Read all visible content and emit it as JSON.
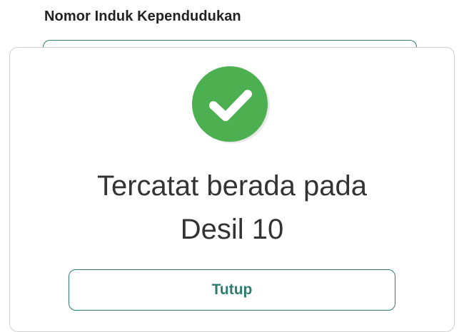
{
  "form": {
    "nik_label": "Nomor Induk Kependudukan",
    "nik_value": ""
  },
  "dialog": {
    "icon": "check-circle-icon",
    "icon_color": "#4caf50",
    "message_line1": "Tercatat berada pada",
    "message_line2": "Desil 10",
    "close_label": "Tutup",
    "accent_color": "#2e7d6e"
  }
}
